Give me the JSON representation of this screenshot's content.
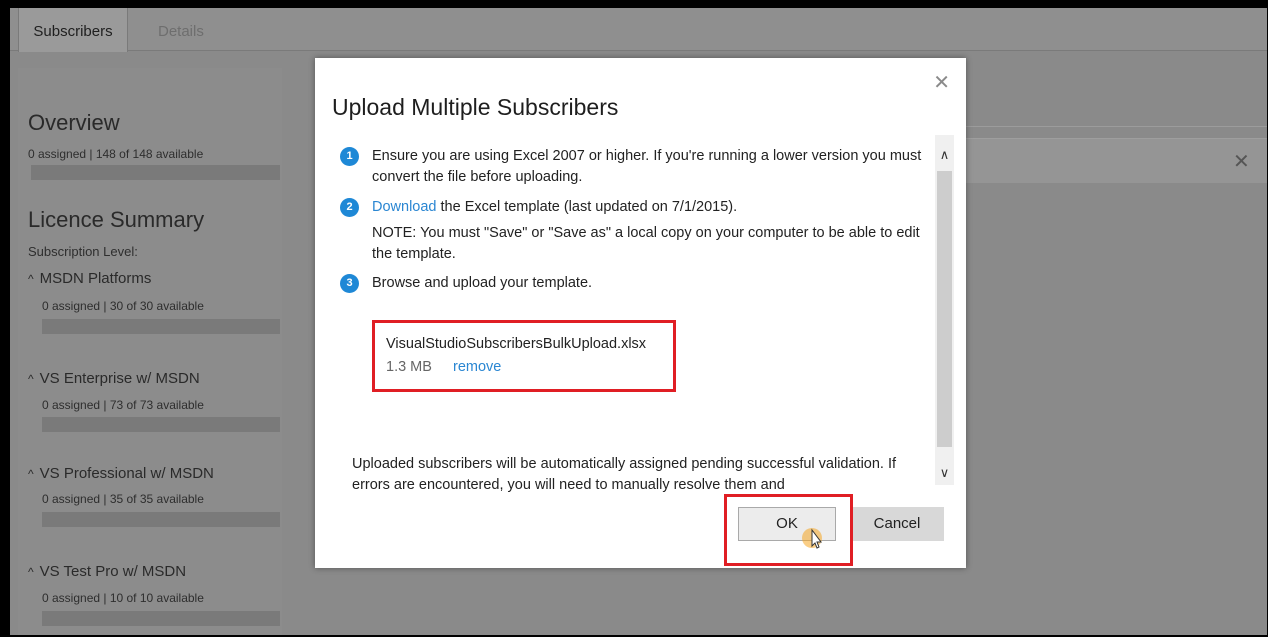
{
  "tabs": [
    {
      "label": "Subscribers",
      "active": true
    },
    {
      "label": "Details",
      "active": false
    }
  ],
  "overview": {
    "title": "Overview",
    "status": "0 assigned | 148 of 148 available"
  },
  "licence": {
    "title": "Licence Summary",
    "subscription_label": "Subscription Level:",
    "levels": [
      {
        "name": "MSDN Platforms",
        "status": "0 assigned | 30 of 30 available"
      },
      {
        "name": "VS Enterprise w/ MSDN",
        "status": "0 assigned | 73 of 73 available"
      },
      {
        "name": "VS Professional w/ MSDN",
        "status": "0 assigned | 35 of 35 available"
      },
      {
        "name": "VS Test Pro w/ MSDN",
        "status": "0 assigned | 10 of 10 available"
      }
    ]
  },
  "modal": {
    "title": "Upload Multiple Subscribers",
    "close_glyph": "✕",
    "steps": [
      {
        "num": "1",
        "text": "Ensure you are using Excel 2007 or higher. If you're running a lower version you must convert the file before uploading."
      },
      {
        "num": "2",
        "link": "Download",
        "text": " the Excel template (last updated on 7/1/2015).",
        "note": "NOTE: You must \"Save\" or \"Save as\" a local copy on your computer to be able to edit the template."
      },
      {
        "num": "3",
        "text": "Browse and upload your template."
      }
    ],
    "file": {
      "name": "VisualStudioSubscribersBulkUpload.xlsx",
      "size": "1.3 MB",
      "remove": "remove"
    },
    "bottom_note": "Uploaded subscribers will be automatically assigned pending successful validation. If errors are encountered, you will need to manually resolve them and",
    "ok_label": "OK",
    "cancel_label": "Cancel"
  },
  "icons": {
    "caret": "^",
    "scroll_up": "⌃",
    "scroll_down": "⌄",
    "bg_close": "✕"
  },
  "colors": {
    "accent": "#1e88d6",
    "highlight": "#e01e24"
  }
}
